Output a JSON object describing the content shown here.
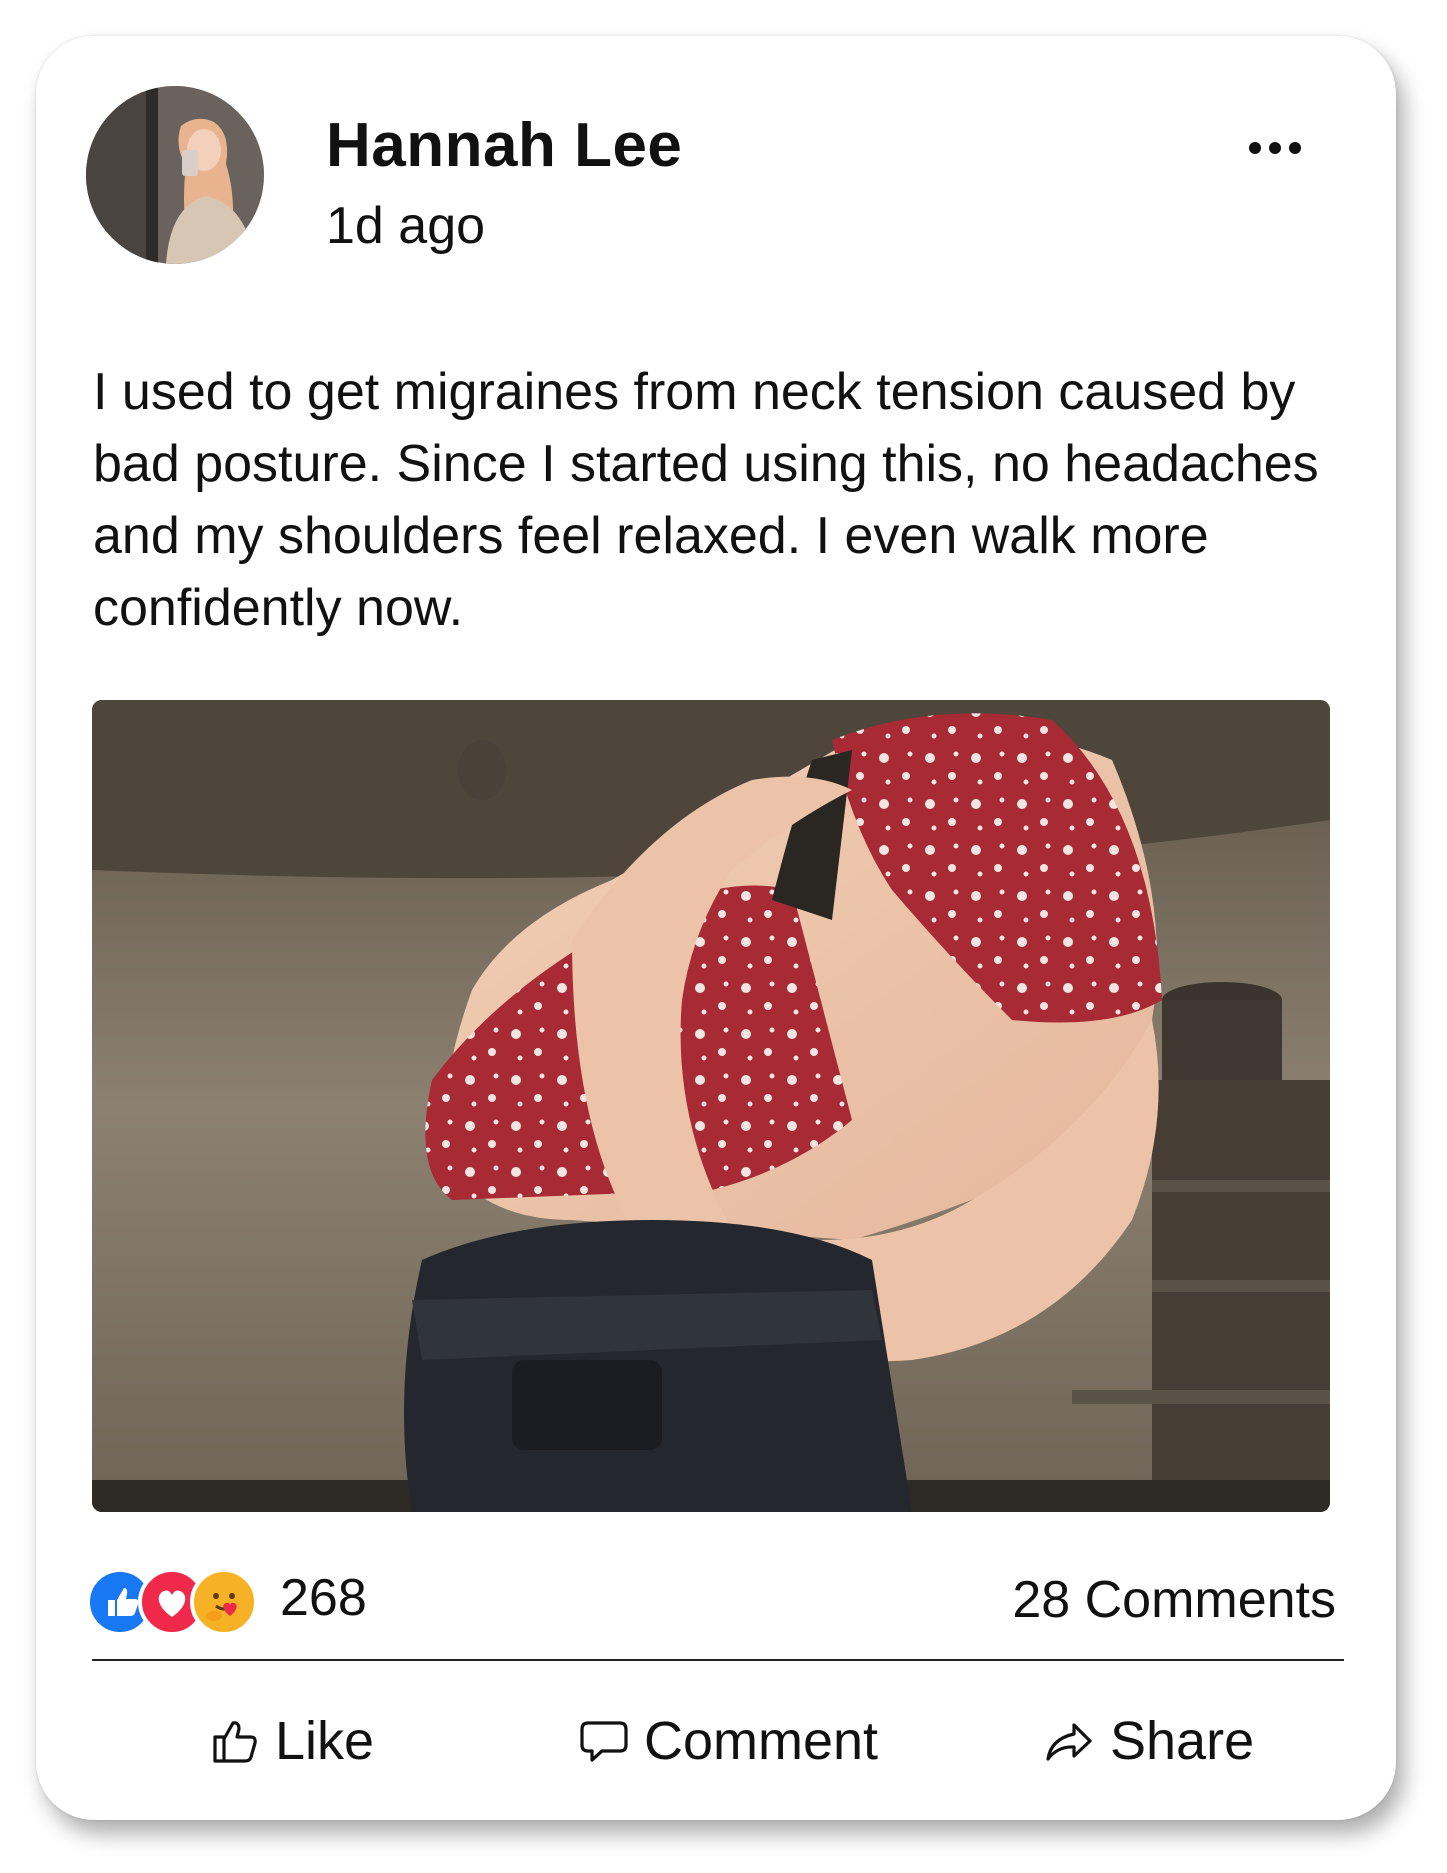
{
  "post": {
    "author": "Hannah Lee",
    "timestamp": "1d ago",
    "text": "I used to get migraines from neck tension caused by bad posture. Since I started using this, no headaches and my shoulders feel relaxed. I even walk more confidently now."
  },
  "stats": {
    "reaction_count": "268",
    "comments_label": "28 Comments",
    "reactions": [
      "like-icon",
      "love-icon",
      "care-icon"
    ]
  },
  "actions": {
    "like": "Like",
    "comment": "Comment",
    "share": "Share"
  },
  "colors": {
    "like_blue": "#1877F2",
    "love_red": "#F02849",
    "care_yellow": "#F7B125"
  }
}
